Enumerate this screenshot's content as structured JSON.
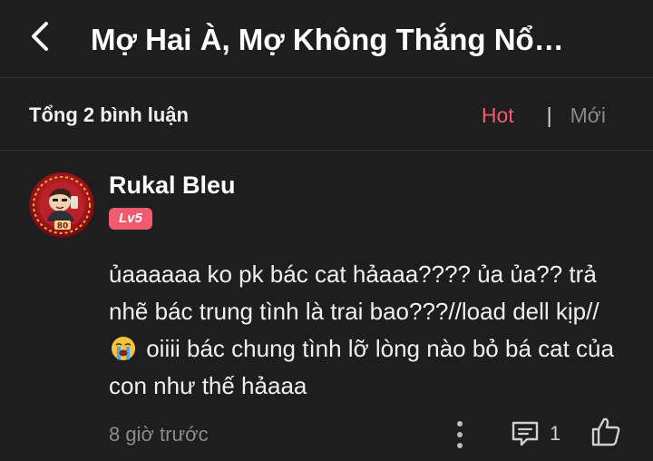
{
  "header": {
    "title": "Mợ Hai À, Mợ Không Thắng Nổ…",
    "back_icon": "chevron-left-icon"
  },
  "comments_bar": {
    "total_label": "Tổng 2 bình luận",
    "sort_hot": "Hot",
    "sort_separator": "|",
    "sort_new": "Mới",
    "active_sort": "Hot"
  },
  "comment": {
    "avatar_badge": "80",
    "username": "Rukal Bleu",
    "level": "Lv5",
    "text_before_emoji": "ủaaaaaa ko pk bác cat hảaaa???? ủa ủa?? trả nhẽ bác trung tình là trai bao???//load dell kịp//",
    "emoji": "loudly-crying-face",
    "text_after_emoji": " oiiii bác chung tình lỡ lòng nào bỏ bá cat của con như thế hảaaa",
    "timestamp": "8 giờ trước",
    "reply_count": "1",
    "icons": {
      "more": "more-vertical-icon",
      "reply": "comment-icon",
      "like": "thumbs-up-icon"
    }
  },
  "colors": {
    "background": "#1e1e1e",
    "accent": "#f25b6e",
    "divider": "#333333",
    "muted_text": "#8c8c8c"
  }
}
